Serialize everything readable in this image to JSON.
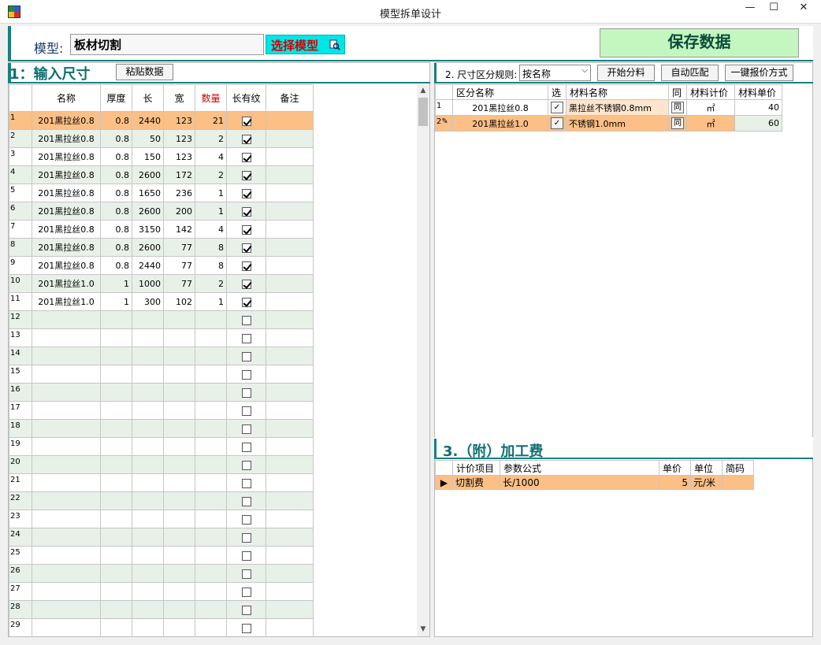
{
  "window": {
    "title": "模型拆单设计",
    "min_glyph": "—",
    "max_glyph": "☐",
    "close_glyph": "✕"
  },
  "model": {
    "label": "模型:",
    "value": "板材切割",
    "choose_button": "选择模型",
    "choose_icon": "magnifier-document-icon"
  },
  "save_button": "保存数据",
  "section1": {
    "title": "1：输入尺寸",
    "paste_button": "粘贴数据",
    "headers": [
      "名称",
      "厚度",
      "长",
      "宽",
      "数量",
      "长有纹",
      "备注"
    ],
    "rows": [
      {
        "n": "1",
        "name": "201黑拉丝0.8",
        "thick": "0.8",
        "len": "2440",
        "wid": "123",
        "qty": "21",
        "grain": true,
        "note": ""
      },
      {
        "n": "2",
        "name": "201黑拉丝0.8",
        "thick": "0.8",
        "len": "50",
        "wid": "123",
        "qty": "2",
        "grain": true,
        "note": ""
      },
      {
        "n": "3",
        "name": "201黑拉丝0.8",
        "thick": "0.8",
        "len": "150",
        "wid": "123",
        "qty": "4",
        "grain": true,
        "note": ""
      },
      {
        "n": "4",
        "name": "201黑拉丝0.8",
        "thick": "0.8",
        "len": "2600",
        "wid": "172",
        "qty": "2",
        "grain": true,
        "note": ""
      },
      {
        "n": "5",
        "name": "201黑拉丝0.8",
        "thick": "0.8",
        "len": "1650",
        "wid": "236",
        "qty": "1",
        "grain": true,
        "note": ""
      },
      {
        "n": "6",
        "name": "201黑拉丝0.8",
        "thick": "0.8",
        "len": "2600",
        "wid": "200",
        "qty": "1",
        "grain": true,
        "note": ""
      },
      {
        "n": "7",
        "name": "201黑拉丝0.8",
        "thick": "0.8",
        "len": "3150",
        "wid": "142",
        "qty": "4",
        "grain": true,
        "note": ""
      },
      {
        "n": "8",
        "name": "201黑拉丝0.8",
        "thick": "0.8",
        "len": "2600",
        "wid": "77",
        "qty": "8",
        "grain": true,
        "note": ""
      },
      {
        "n": "9",
        "name": "201黑拉丝0.8",
        "thick": "0.8",
        "len": "2440",
        "wid": "77",
        "qty": "8",
        "grain": true,
        "note": ""
      },
      {
        "n": "10",
        "name": "201黑拉丝1.0",
        "thick": "1",
        "len": "1000",
        "wid": "77",
        "qty": "2",
        "grain": true,
        "note": ""
      },
      {
        "n": "11",
        "name": "201黑拉丝1.0",
        "thick": "1",
        "len": "300",
        "wid": "102",
        "qty": "1",
        "grain": true,
        "note": ""
      },
      {
        "n": "12",
        "name": "",
        "thick": "",
        "len": "",
        "wid": "",
        "qty": "",
        "grain": false,
        "note": ""
      },
      {
        "n": "13",
        "name": "",
        "thick": "",
        "len": "",
        "wid": "",
        "qty": "",
        "grain": false,
        "note": ""
      },
      {
        "n": "14",
        "name": "",
        "thick": "",
        "len": "",
        "wid": "",
        "qty": "",
        "grain": false,
        "note": ""
      },
      {
        "n": "15",
        "name": "",
        "thick": "",
        "len": "",
        "wid": "",
        "qty": "",
        "grain": false,
        "note": ""
      },
      {
        "n": "16",
        "name": "",
        "thick": "",
        "len": "",
        "wid": "",
        "qty": "",
        "grain": false,
        "note": ""
      },
      {
        "n": "17",
        "name": "",
        "thick": "",
        "len": "",
        "wid": "",
        "qty": "",
        "grain": false,
        "note": ""
      },
      {
        "n": "18",
        "name": "",
        "thick": "",
        "len": "",
        "wid": "",
        "qty": "",
        "grain": false,
        "note": ""
      },
      {
        "n": "19",
        "name": "",
        "thick": "",
        "len": "",
        "wid": "",
        "qty": "",
        "grain": false,
        "note": ""
      },
      {
        "n": "20",
        "name": "",
        "thick": "",
        "len": "",
        "wid": "",
        "qty": "",
        "grain": false,
        "note": ""
      },
      {
        "n": "21",
        "name": "",
        "thick": "",
        "len": "",
        "wid": "",
        "qty": "",
        "grain": false,
        "note": ""
      },
      {
        "n": "22",
        "name": "",
        "thick": "",
        "len": "",
        "wid": "",
        "qty": "",
        "grain": false,
        "note": ""
      },
      {
        "n": "23",
        "name": "",
        "thick": "",
        "len": "",
        "wid": "",
        "qty": "",
        "grain": false,
        "note": ""
      },
      {
        "n": "24",
        "name": "",
        "thick": "",
        "len": "",
        "wid": "",
        "qty": "",
        "grain": false,
        "note": ""
      },
      {
        "n": "25",
        "name": "",
        "thick": "",
        "len": "",
        "wid": "",
        "qty": "",
        "grain": false,
        "note": ""
      },
      {
        "n": "26",
        "name": "",
        "thick": "",
        "len": "",
        "wid": "",
        "qty": "",
        "grain": false,
        "note": ""
      },
      {
        "n": "27",
        "name": "",
        "thick": "",
        "len": "",
        "wid": "",
        "qty": "",
        "grain": false,
        "note": ""
      },
      {
        "n": "28",
        "name": "",
        "thick": "",
        "len": "",
        "wid": "",
        "qty": "",
        "grain": false,
        "note": ""
      },
      {
        "n": "29",
        "name": "",
        "thick": "",
        "len": "",
        "wid": "",
        "qty": "",
        "grain": false,
        "note": ""
      }
    ]
  },
  "section2": {
    "rule_label": "2. 尺寸区分规则:",
    "rule_value": "按名称",
    "buttons": {
      "start": "开始分料",
      "auto": "自动匹配",
      "quote": "一键报价方式"
    },
    "headers": [
      "区分名称",
      "选",
      "材料名称",
      "同",
      "材料计价",
      "材料单价"
    ],
    "rows": [
      {
        "n": "1",
        "key": "201黑拉丝0.8",
        "sel": "✓",
        "material": "黑拉丝不锈钢0.8mm",
        "same": "同",
        "unit": "㎡",
        "price": "40"
      },
      {
        "n": "2",
        "key": "201黑拉丝1.0",
        "sel": "✓",
        "material": "不锈钢1.0mm",
        "same": "同",
        "unit": "㎡",
        "price": "60"
      }
    ]
  },
  "section3": {
    "title": "3.（附）加工费",
    "headers": [
      "计价项目",
      "参数公式",
      "单价",
      "单位",
      "简码"
    ],
    "rows": [
      {
        "item": "切割费",
        "formula": "长/1000",
        "price": "5",
        "unit": "元/米",
        "code": ""
      }
    ]
  }
}
